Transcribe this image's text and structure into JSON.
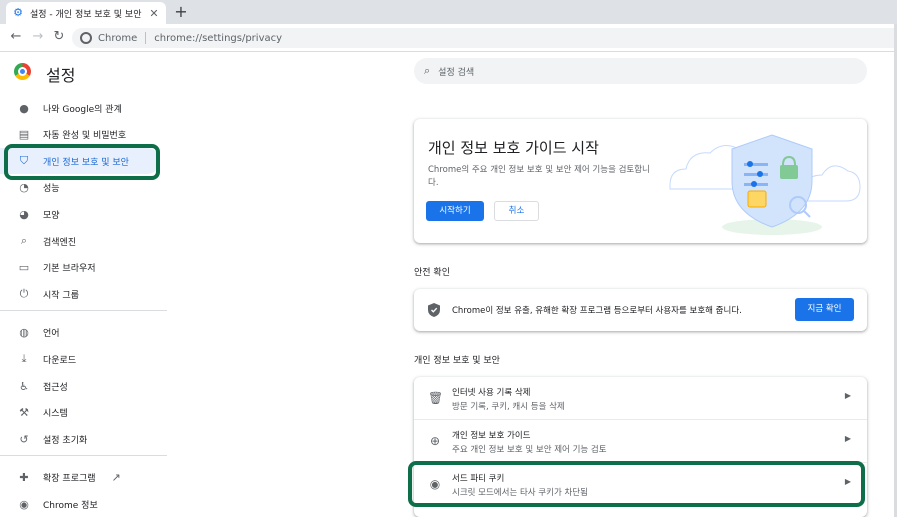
{
  "browser": {
    "tab_title": "설정 - 개인 정보 보호 및 보안",
    "tab_close": "✕",
    "new_tab": "+",
    "url_chip": "Chrome",
    "url": "chrome://settings/privacy"
  },
  "settings": {
    "title": "설정",
    "search_placeholder": "설정 검색"
  },
  "sidebar": {
    "items": [
      {
        "label": "나와 Google의 관계",
        "icon": "person-icon"
      },
      {
        "label": "자동 완성 및 비밀번호",
        "icon": "clipboard-icon"
      },
      {
        "label": "개인 정보 보호 및 보안",
        "icon": "shield-icon",
        "active": true
      },
      {
        "label": "성능",
        "icon": "speedometer-icon"
      },
      {
        "label": "모양",
        "icon": "palette-icon"
      },
      {
        "label": "검색엔진",
        "icon": "search-icon"
      },
      {
        "label": "기본 브라우저",
        "icon": "browser-icon"
      },
      {
        "label": "시작 그룹",
        "icon": "power-icon"
      },
      {
        "label": "언어",
        "icon": "globe-icon"
      },
      {
        "label": "다운로드",
        "icon": "download-icon"
      },
      {
        "label": "접근성",
        "icon": "accessibility-icon"
      },
      {
        "label": "시스템",
        "icon": "wrench-icon"
      },
      {
        "label": "설정 초기화",
        "icon": "history-icon"
      },
      {
        "label": "확장 프로그램",
        "icon": "puzzle-icon"
      },
      {
        "label": "Chrome 정보",
        "icon": "chrome-icon"
      }
    ]
  },
  "guide_card": {
    "title": "개인 정보 보호 가이드 시작",
    "description": "Chrome의 주요 개인 정보 보호 및 보안 제어 기능을 검토합니다.",
    "start_label": "시작하기",
    "cancel_label": "취소"
  },
  "safety": {
    "section_title": "안전 확인",
    "text": "Chrome이 정보 유출, 유해한 확장 프로그램 등으로부터 사용자를 보호해 줍니다.",
    "button_label": "지금 확인"
  },
  "privacy": {
    "section_title": "개인 정보 보호 및 보안",
    "rows": [
      {
        "label": "인터넷 사용 기록 삭제",
        "sub": "방문 기록, 쿠키, 캐시 등을 삭제",
        "icon": "trash-icon"
      },
      {
        "label": "개인 정보 보호 가이드",
        "sub": "주요 개인 정보 보호 및 보안 제어 기능 검토",
        "icon": "compass-icon"
      },
      {
        "label": "서드 파티 쿠키",
        "sub": "시크릿 모드에서는 타사 쿠키가 차단됨",
        "icon": "cookie-icon"
      }
    ]
  },
  "colors": {
    "accent": "#1a73e8",
    "highlight": "#0f6e4a",
    "active_bg": "#e8f0fe"
  }
}
